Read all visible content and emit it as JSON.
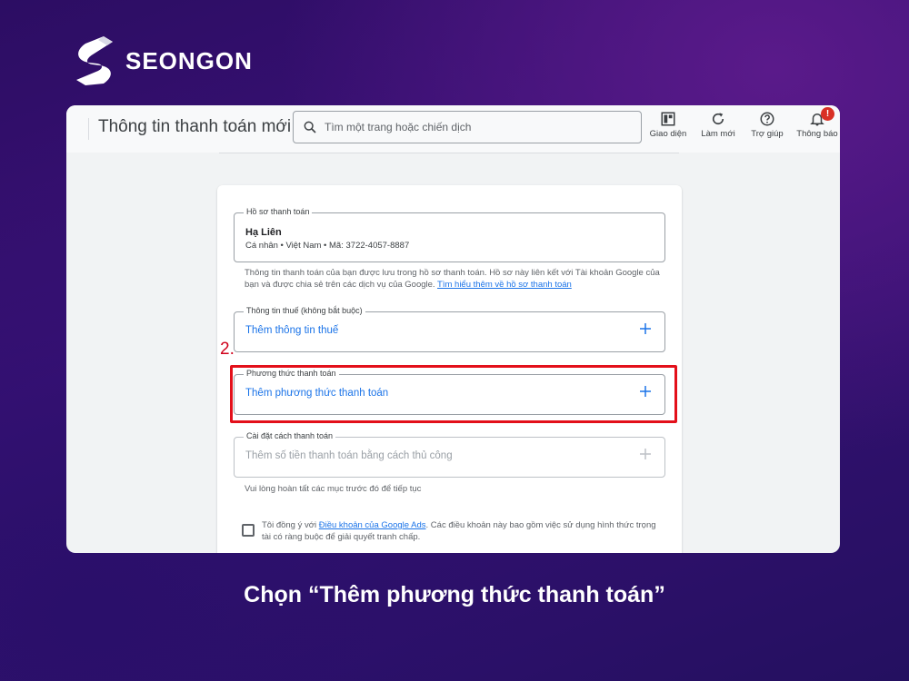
{
  "brand": {
    "name": "SEONGON"
  },
  "topbar": {
    "title": "Thông tin thanh toán mới",
    "search_placeholder": "Tìm một trang hoặc chiến dịch",
    "tools": [
      {
        "label": "Giao diện",
        "icon": "layout-icon"
      },
      {
        "label": "Làm mới",
        "icon": "refresh-icon"
      },
      {
        "label": "Trợ giúp",
        "icon": "help-icon"
      },
      {
        "label": "Thông báo",
        "icon": "bell-icon",
        "badge": "!"
      }
    ]
  },
  "profile": {
    "legend": "Hồ sơ thanh toán",
    "name": "Hạ Liên",
    "details": "Cá nhân • Việt Nam • Mã: 3722-4057-8887",
    "help_text": "Thông tin thanh toán của bạn được lưu trong hồ sơ thanh toán. Hồ sơ này liên kết với Tài khoản Google của bạn và được chia sẻ trên các dịch vụ của Google.",
    "help_link": "Tìm hiểu thêm về hồ sơ thanh toán"
  },
  "tax": {
    "legend": "Thông tin thuế (không bắt buộc)",
    "action": "Thêm thông tin thuế"
  },
  "payment_method": {
    "legend": "Phương thức thanh toán",
    "action": "Thêm phương thức thanh toán"
  },
  "payment_setup": {
    "legend": "Cài đặt cách thanh toán",
    "action": "Thêm số tiền thanh toán bằng cách thủ công",
    "note": "Vui lòng hoàn tất các mục trước đó để tiếp tục"
  },
  "terms": {
    "prefix": "Tôi đồng ý với",
    "link": "Điều khoản của Google Ads",
    "suffix": ". Các điều khoản này bao gồm việc sử dụng hình thức trọng tài có ràng buộc để giải quyết tranh chấp."
  },
  "annotation": {
    "step": "2."
  },
  "caption": "Chọn “Thêm phương thức thanh toán”",
  "colors": {
    "accent": "#1a73e8",
    "highlight": "#e3101a",
    "badge": "#d93025"
  }
}
